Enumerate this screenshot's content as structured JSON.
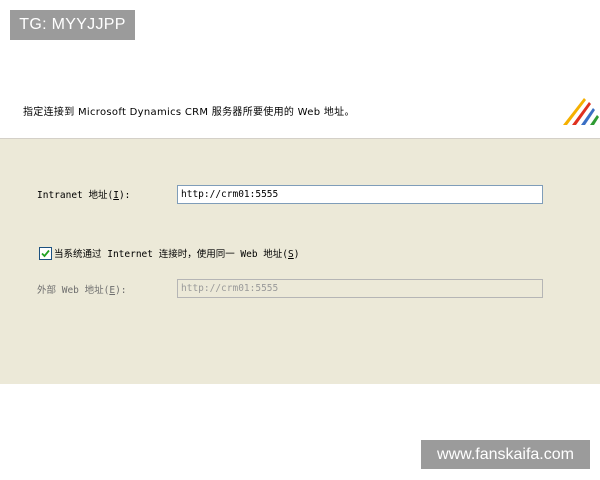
{
  "watermarks": {
    "top_left": "TG: MYYJJPP",
    "bottom_right": "www.fanskaifa.com"
  },
  "header": {
    "instruction": "指定连接到 Microsoft Dynamics CRM 服务器所要使用的 Web 地址。",
    "logo_icon": "microsoft-dynamics-logo-icon"
  },
  "form": {
    "intranet": {
      "label_prefix": "Intranet 地址(",
      "label_key": "I",
      "label_suffix": "):",
      "value": "http://crm01:5555"
    },
    "same_address": {
      "checked": true,
      "label_prefix": "当系统通过 Internet 连接时，使用同一 Web 地址(",
      "label_key": "S",
      "label_suffix": ")"
    },
    "external": {
      "label_prefix": "外部 Web 地址(",
      "label_key": "E",
      "label_suffix": "):",
      "value": "http://crm01:5555",
      "disabled": true
    }
  },
  "colors": {
    "panel_background": "#ece9d8",
    "input_border": "#7f9db9",
    "checkmark": "#21a121",
    "logo": [
      "#f5b000",
      "#e0301e",
      "#3a6fc4",
      "#2e9b34"
    ]
  }
}
